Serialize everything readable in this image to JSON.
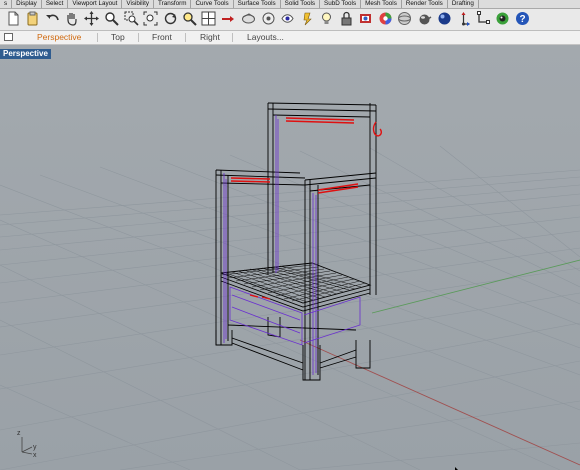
{
  "ribbon_tabs": [
    "s",
    "Display",
    "Select",
    "Viewport Layout",
    "Visibility",
    "Transform",
    "Curve Tools",
    "Surface Tools",
    "Solid Tools",
    "SubD Tools",
    "Mesh Tools",
    "Render Tools",
    "Drafting"
  ],
  "viewport_tabs": [
    "Perspective",
    "Top",
    "Front",
    "Right",
    "Layouts..."
  ],
  "active_viewport_label": "Perspective",
  "axis_labels": {
    "z": "z",
    "y": "y",
    "x": "x"
  },
  "colors": {
    "active_tab": "#d06a10",
    "viewport_bg": "#9ea6ad",
    "label_bg": "#2f5c8f",
    "grid_x_axis": "#a05050",
    "grid_y_axis": "#5a9a5a",
    "object_wire": "#000000",
    "selected_wire": "#e01010",
    "inner_wire": "#6a2fd0"
  },
  "toolbar_icons": [
    "new-icon",
    "clipboard-icon",
    "undo-icon",
    "pan-icon",
    "move-icon",
    "zoom-icon",
    "zoom-window-icon",
    "zoom-extents-icon",
    "rotate-view-icon",
    "zoom-selected-icon",
    "four-viewports-icon",
    "options-icon",
    "select-icon",
    "hide-icon",
    "show-icon",
    "lock-icon",
    "light-icon",
    "lightbulb-icon",
    "lock-closed-icon",
    "layer-icon",
    "material-icon",
    "sphere-render-icon",
    "teapot-icon",
    "sphere-shaded-icon",
    "gumball-icon",
    "osnap-icon",
    "color-wheel-icon",
    "help-icon"
  ]
}
